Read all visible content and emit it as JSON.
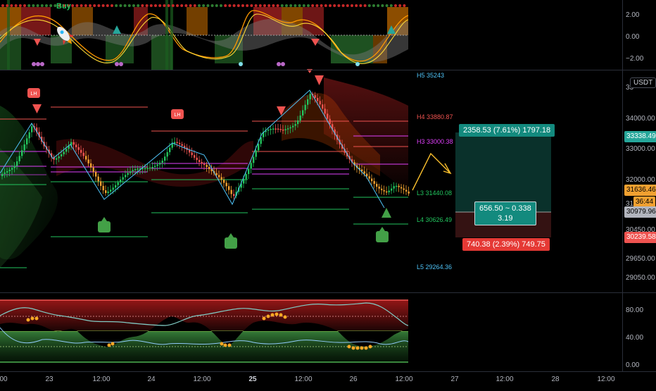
{
  "top_indicator": {
    "buy_label": "Buy",
    "axis": [
      "2.00",
      "0.00",
      "−2.00"
    ]
  },
  "main_chart": {
    "unit": "USDT",
    "price_axis": [
      "34000.00",
      "33000.00",
      "32000.00",
      "30450.00",
      "29650.00",
      "29050.00"
    ],
    "price_axis_clipped": [
      "33",
      "31"
    ],
    "level_labels": {
      "h5": "H5 35243",
      "h4": "H4 33880.87",
      "h3": "H3 33000.38",
      "l3": "L3 31440.08",
      "l4": "L4 30626.49",
      "l5": "L5 29264.36"
    },
    "lh_labels": [
      "LH",
      "LH"
    ],
    "price_tags": {
      "target": "33338.49",
      "current_a": "31636.46",
      "countdown": "36:44",
      "entry": "30979.96",
      "stop": "30239.58"
    },
    "position": {
      "target_text": "2358.53 (7.61%) 1797.18",
      "ratio_line1": "656.50 ~ 0.338",
      "ratio_line2": "3.19",
      "stop_text": "740.38 (2.39%) 749.75"
    }
  },
  "bottom_indicator": {
    "axis": [
      "80.00",
      "40.00",
      "0.00"
    ]
  },
  "time_axis": [
    "00",
    "23",
    "12:00",
    "24",
    "12:00",
    "25",
    "12:00",
    "26",
    "12:00",
    "27",
    "12:00",
    "28",
    "12:00"
  ],
  "colors": {
    "up": "#22c55e",
    "down": "#ef5350",
    "orange": "#f0a030",
    "teal": "#26a69a",
    "zigzag": "#4fc3f7",
    "magenta": "#e040fb",
    "grid": "#2a2e39"
  }
}
